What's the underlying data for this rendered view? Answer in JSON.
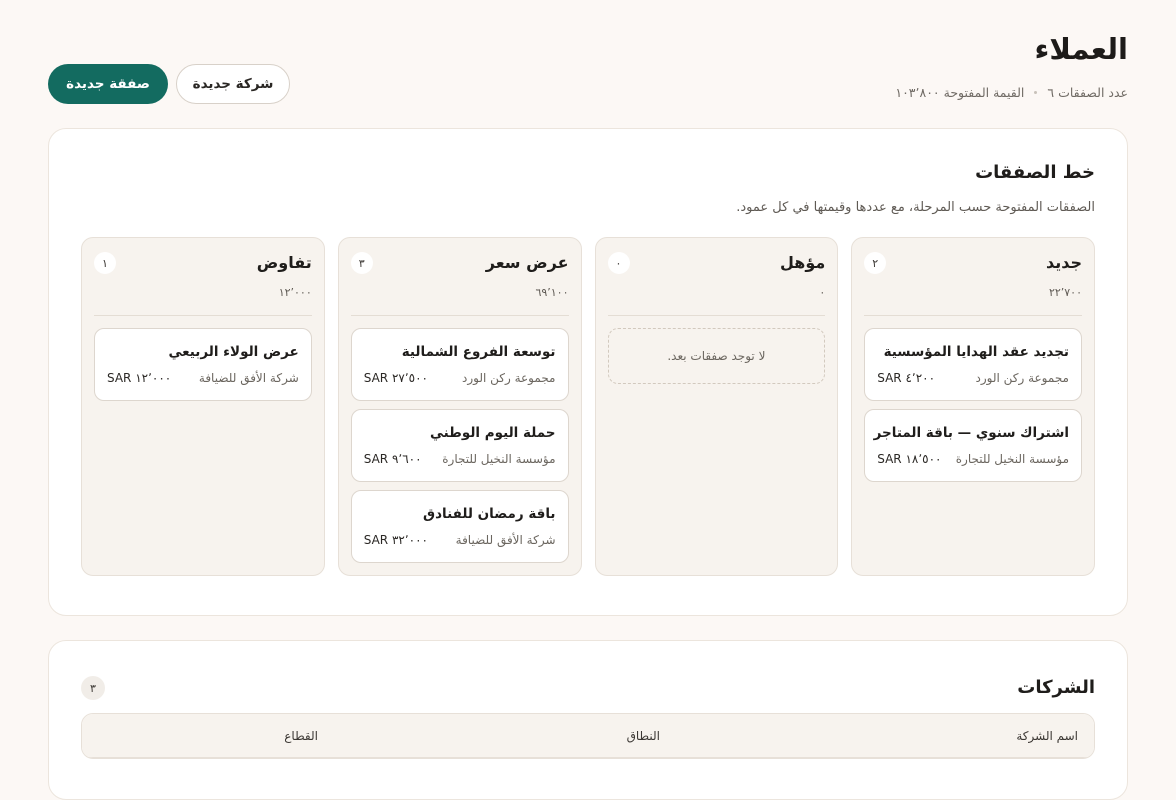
{
  "header": {
    "title": "العملاء",
    "deals_count_label": "عدد الصفقات ٦",
    "open_value_label": "القيمة المفتوحة ١٠٣٬٨٠٠",
    "new_deal_button": "صفقة جديدة",
    "new_company_button": "شركة جديدة"
  },
  "pipeline": {
    "title": "خط الصفقات",
    "description": "الصفقات المفتوحة حسب المرحلة، مع عددها وقيمتها في كل عمود.",
    "columns": [
      {
        "name": "جديد",
        "count": "٢",
        "total": "٢٢٬٧٠٠",
        "empty_text": "",
        "deals": [
          {
            "title": "تجديد عقد الهدايا المؤسسية",
            "company": "مجموعة ركن الورد",
            "value": "SAR ٤٬٢٠٠"
          },
          {
            "title": "اشتراك سنوي — باقة المتاجر",
            "company": "مؤسسة النخيل للتجارة",
            "value": "SAR ١٨٬٥٠٠"
          }
        ]
      },
      {
        "name": "مؤهل",
        "count": "٠",
        "total": "٠",
        "empty_text": "لا توجد صفقات بعد.",
        "deals": []
      },
      {
        "name": "عرض سعر",
        "count": "٣",
        "total": "٦٩٬١٠٠",
        "empty_text": "",
        "deals": [
          {
            "title": "توسعة الفروع الشمالية",
            "company": "مجموعة ركن الورد",
            "value": "SAR ٢٧٬٥٠٠"
          },
          {
            "title": "حملة اليوم الوطني",
            "company": "مؤسسة النخيل للتجارة",
            "value": "SAR ٩٬٦٠٠"
          },
          {
            "title": "باقة رمضان للفنادق",
            "company": "شركة الأفق للضيافة",
            "value": "SAR ٣٢٬٠٠٠"
          }
        ]
      },
      {
        "name": "تفاوض",
        "count": "١",
        "total": "١٢٬٠٠٠",
        "empty_text": "",
        "deals": [
          {
            "title": "عرض الولاء الربيعي",
            "company": "شركة الأفق للضيافة",
            "value": "SAR ١٢٬٠٠٠"
          }
        ]
      }
    ]
  },
  "companies": {
    "title": "الشركات",
    "count": "٣",
    "columns": [
      "اسم الشركة",
      "النطاق",
      "القطاع"
    ]
  },
  "colors": {
    "accent": "#136b60",
    "background": "#fcf8f5",
    "column_bg": "#f7f3ee"
  }
}
